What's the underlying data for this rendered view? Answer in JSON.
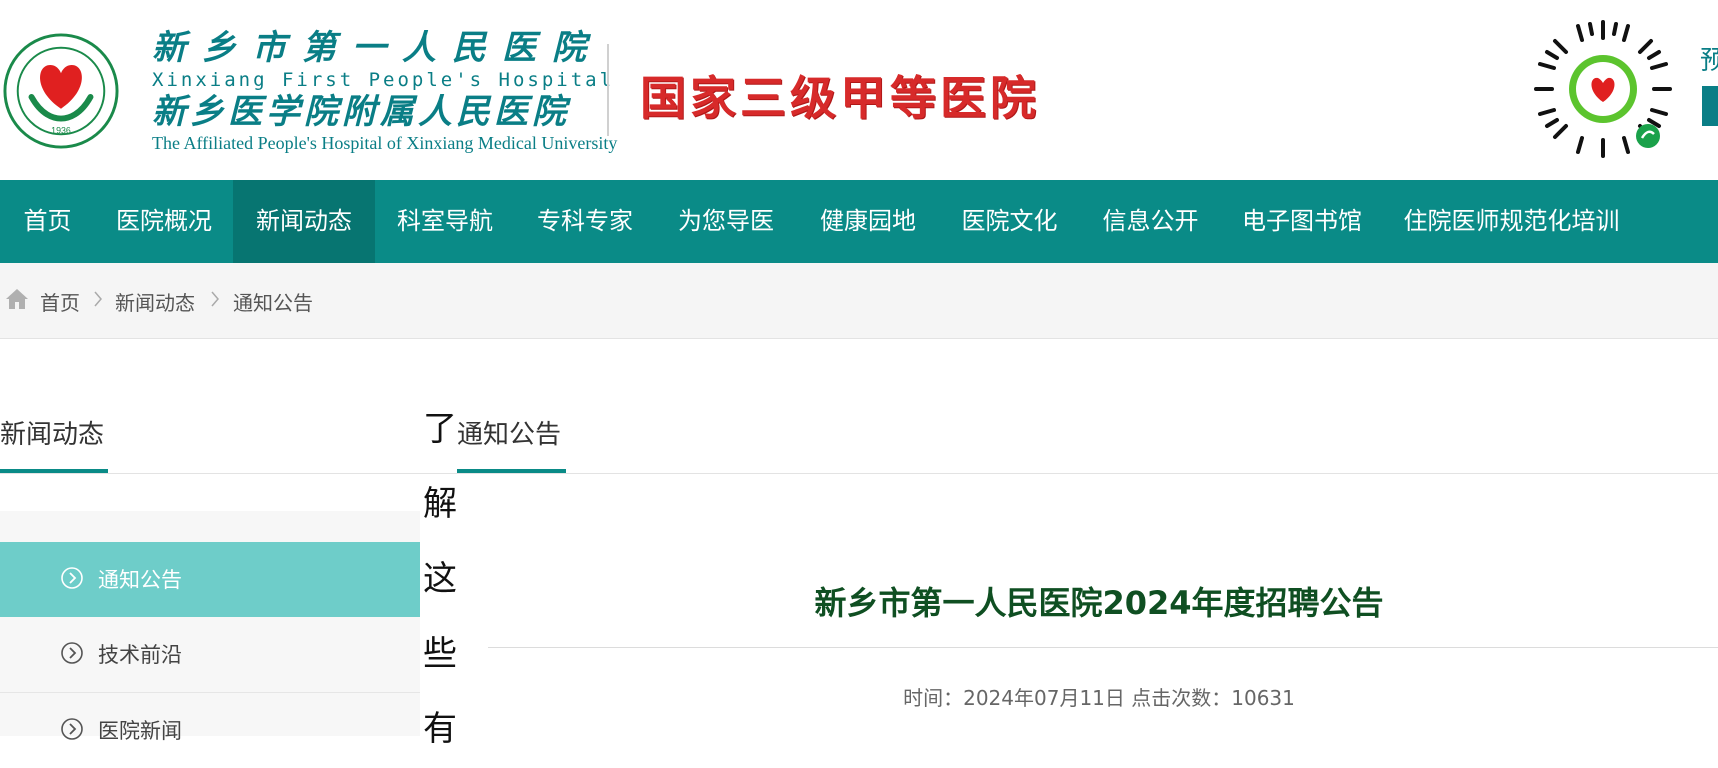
{
  "header": {
    "name_cn": "新乡市第一人民医院",
    "name_en": "Xinxiang First People's Hospital",
    "affiliated_cn": "新乡医学院附属人民医院",
    "affiliated_en": "The Affiliated People's Hospital of Xinxiang Medical University",
    "logo_year": "1936",
    "slogan": "国家三级甲等医院",
    "right_text": "预",
    "brand_color": "#0a8b87",
    "slogan_color": "#d72a2a"
  },
  "nav": {
    "items": [
      {
        "label": "首页"
      },
      {
        "label": "医院概况"
      },
      {
        "label": "新闻动态"
      },
      {
        "label": "科室导航"
      },
      {
        "label": "专科专家"
      },
      {
        "label": "为您导医"
      },
      {
        "label": "健康园地"
      },
      {
        "label": "医院文化"
      },
      {
        "label": "信息公开"
      },
      {
        "label": "电子图书馆"
      },
      {
        "label": "住院医师规范化培训"
      }
    ],
    "active": "新闻动态"
  },
  "breadcrumb": {
    "icon": "home-icon",
    "items": [
      "首页",
      "新闻动态",
      "通知公告"
    ]
  },
  "sidebar": {
    "title": "新闻动态",
    "items": [
      {
        "label": "通知公告",
        "active": true
      },
      {
        "label": "技术前沿",
        "active": false
      },
      {
        "label": "医院新闻",
        "active": false
      }
    ]
  },
  "overlay_vertical_text": [
    "了",
    "解",
    "这",
    "些",
    "有"
  ],
  "content": {
    "section_title": "通知公告",
    "article_title": "新乡市第一人民医院2024年度招聘公告",
    "meta": "时间：2024年07月11日 点击次数：10631"
  }
}
